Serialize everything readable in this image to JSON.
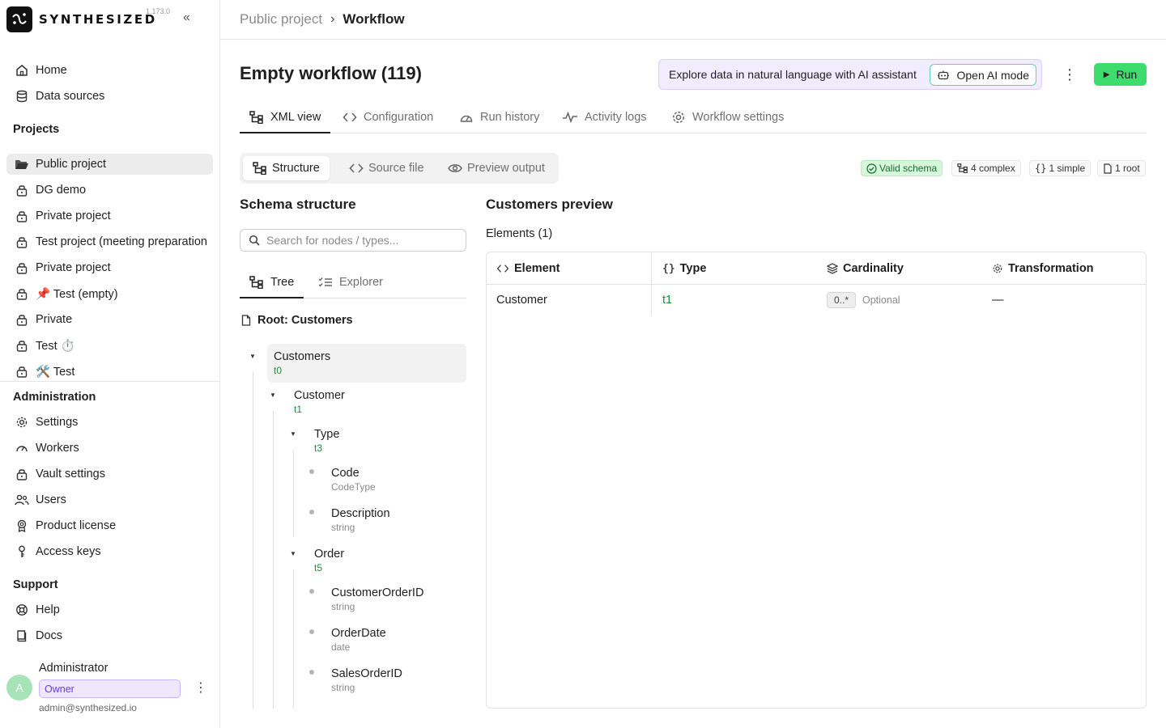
{
  "app": {
    "logo_text": "SYNTHESIZED",
    "version": "1.173.0"
  },
  "sidebar": {
    "top_items": [
      {
        "label": "Home",
        "icon": "home-icon"
      },
      {
        "label": "Data sources",
        "icon": "database-icon"
      }
    ],
    "projects_heading": "Projects",
    "projects": [
      {
        "label": "Public project",
        "icon": "folder-open-icon",
        "active": true
      },
      {
        "label": "DG demo",
        "icon": "lock-icon"
      },
      {
        "label": "Private project",
        "icon": "lock-icon"
      },
      {
        "label": "Test project (meeting preparation",
        "icon": "lock-icon"
      },
      {
        "label": "Private project",
        "icon": "lock-icon"
      },
      {
        "label": "📌 Test (empty)",
        "icon": "lock-icon"
      },
      {
        "label": "Private",
        "icon": "lock-icon"
      },
      {
        "label": "Test ⏱️",
        "icon": "lock-icon"
      },
      {
        "label": "🛠️ Test",
        "icon": "lock-icon"
      }
    ],
    "admin_heading": "Administration",
    "admin_items": [
      {
        "label": "Settings",
        "icon": "gear-icon"
      },
      {
        "label": "Workers",
        "icon": "gauge-icon"
      },
      {
        "label": "Vault settings",
        "icon": "lock-icon"
      },
      {
        "label": "Users",
        "icon": "users-icon"
      },
      {
        "label": "Product license",
        "icon": "badge-icon"
      },
      {
        "label": "Access keys",
        "icon": "key-icon"
      }
    ],
    "support_heading": "Support",
    "support_items": [
      {
        "label": "Help",
        "icon": "lifebuoy-icon"
      },
      {
        "label": "Docs",
        "icon": "book-icon"
      }
    ],
    "user": {
      "initial": "A",
      "name": "Administrator",
      "role": "Owner",
      "email": "admin@synthesized.io"
    }
  },
  "breadcrumb": {
    "parent": "Public project",
    "separator": "›",
    "current": "Workflow"
  },
  "header": {
    "title": "Empty workflow (119)",
    "ai_banner_text": "Explore data in natural language with AI assistant",
    "ai_button_label": "Open AI mode",
    "run_label": "Run"
  },
  "tabs": [
    {
      "label": "XML view",
      "icon": "hierarchy-icon",
      "active": true
    },
    {
      "label": "Configuration",
      "icon": "code-icon"
    },
    {
      "label": "Run history",
      "icon": "gauge-icon"
    },
    {
      "label": "Activity logs",
      "icon": "activity-icon"
    },
    {
      "label": "Workflow settings",
      "icon": "gear-icon"
    }
  ],
  "view_switch": [
    {
      "label": "Structure",
      "icon": "hierarchy-icon",
      "active": true
    },
    {
      "label": "Source file",
      "icon": "code-icon"
    },
    {
      "label": "Preview output",
      "icon": "eye-icon"
    }
  ],
  "stats": {
    "valid": "Valid schema",
    "complex": "4 complex",
    "simple": "1 simple",
    "root": "1 root"
  },
  "schema": {
    "heading": "Schema structure",
    "search_placeholder": "Search for nodes / types...",
    "subtabs": [
      {
        "label": "Tree",
        "icon": "hierarchy-icon",
        "active": true
      },
      {
        "label": "Explorer",
        "icon": "checklist-icon"
      }
    ],
    "root_label": "Root: Customers",
    "nodes": [
      {
        "name": "Customers",
        "type": "t0"
      },
      {
        "name": "Customer",
        "type": "t1"
      },
      {
        "name": "Type",
        "type": "t3"
      },
      {
        "name": "Code",
        "type": "CodeType"
      },
      {
        "name": "Description",
        "type": "string"
      },
      {
        "name": "Order",
        "type": "t5"
      },
      {
        "name": "CustomerOrderID",
        "type": "string"
      },
      {
        "name": "OrderDate",
        "type": "date"
      },
      {
        "name": "SalesOrderID",
        "type": "string"
      }
    ]
  },
  "preview": {
    "heading": "Customers preview",
    "elements_label": "Elements (1)",
    "columns": [
      "Element",
      "Type",
      "Cardinality",
      "Transformation"
    ],
    "rows": [
      {
        "element": "Customer",
        "type": "t1",
        "cardinality": "0..*",
        "optional": "Optional",
        "transformation": "—"
      }
    ]
  },
  "colors": {
    "accent_green": "#3ddc6c",
    "type_green": "#1e8c3a",
    "ai_banner_bg": "#f1ecff",
    "role_purple": "#6b3ad6"
  }
}
